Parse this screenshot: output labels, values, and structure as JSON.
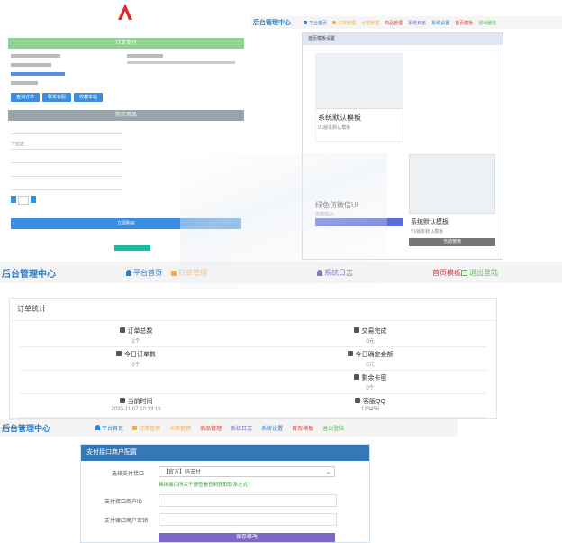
{
  "nav_common": {
    "brand": "后台管理中心",
    "home": "平台首页",
    "orders": "订单管理",
    "cards": "卡密管理",
    "goods": "商品管理",
    "logs": "系统日志",
    "settings": "系统设置",
    "homepage_template": "首页模板",
    "logout": "退出登陆"
  },
  "shop_preview": {
    "buy_header": "订单支付",
    "order_header": "购买商品",
    "btn_search": "查询订单",
    "btn_contact": "联系客服",
    "btn_favorite": "收藏本站",
    "select_placeholder": "下拉选",
    "buy_button": "立即购买"
  },
  "template_panel": {
    "header": "首页模板设置",
    "template1_title": "系统默认模板",
    "template1_sub": "V1版本默认模板",
    "template2_title": "绿色仿微信UI",
    "template2_sub": "仿微信UI",
    "template3_title": "系统默认模板",
    "template3_sub": "V1版本默认模板",
    "template3_btn": "当前使用"
  },
  "dashboard": {
    "header": "订单统计",
    "stats": [
      {
        "label": "订单总数",
        "value": "1个",
        "icon": "list-icon"
      },
      {
        "label": "交易完成",
        "value": "0元",
        "icon": "cart-icon"
      },
      {
        "label": "今日订单数",
        "value": "0个",
        "icon": "wrench-icon"
      },
      {
        "label": "今日确定金额",
        "value": "0元",
        "icon": "check-icon"
      },
      {
        "label": "",
        "value": "",
        "icon": ""
      },
      {
        "label": "剩余卡密",
        "value": "0个",
        "icon": "gear-icon"
      },
      {
        "label": "当前时间",
        "value": "2020-11-07 10:33:18",
        "icon": "clock-icon"
      },
      {
        "label": "客服QQ",
        "value": "123456",
        "icon": "heart-icon"
      }
    ]
  },
  "payment": {
    "header": "支付接口商户配置",
    "label_select": "选择支付接口",
    "select_value": "【官方】码支付",
    "hint": "具体接口所关于请查看官网获取联系方式！",
    "label_id": "支付接口商户ID",
    "label_key": "支付接口商户密钥",
    "save_button": "保存修改"
  },
  "colors": {
    "accent": "#2d7dc6",
    "green": "#5cb85c",
    "red": "#e23a3a",
    "orange": "#f0ad4e",
    "purple": "#7b5bbf",
    "teal": "#1abc9c",
    "header_green": "#8fd18f",
    "submit_purple": "#7c68c9"
  }
}
